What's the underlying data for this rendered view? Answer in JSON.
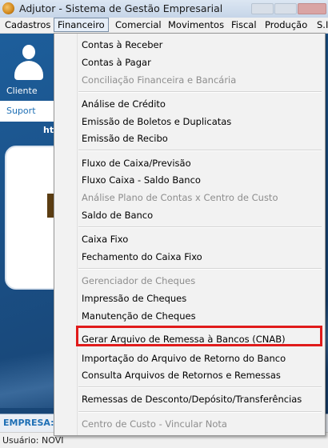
{
  "window": {
    "title": "Adjutor - Sistema de Gestão Empresarial"
  },
  "menubar": {
    "items": [
      "Cadastros",
      "Financeiro",
      "Comercial",
      "Movimentos",
      "Fiscal",
      "Produção",
      "S.I"
    ],
    "active": "Financeiro"
  },
  "background": {
    "clientes_label": "Cliente",
    "suporte_label": "Suport",
    "ht_label": "ht",
    "empresa_label": "EMPRESA:",
    "usuario_label": "Usuário: NOVI"
  },
  "dropdown": {
    "items": [
      {
        "label": "Contas à Receber",
        "enabled": true
      },
      {
        "label": "Contas à Pagar",
        "enabled": true
      },
      {
        "label": "Conciliação Financeira e Bancária",
        "enabled": false
      },
      {
        "label": "Análise de Crédito",
        "enabled": true
      },
      {
        "label": "Emissão de Boletos e Duplicatas",
        "enabled": true
      },
      {
        "label": "Emissão de Recibo",
        "enabled": true
      },
      {
        "label": "Fluxo de Caixa/Previsão",
        "enabled": true
      },
      {
        "label": "Fluxo Caixa - Saldo Banco",
        "enabled": true
      },
      {
        "label": "Análise Plano de Contas x Centro de Custo",
        "enabled": false
      },
      {
        "label": "Saldo de Banco",
        "enabled": true
      },
      {
        "label": "Caixa Fixo",
        "enabled": true
      },
      {
        "label": "Fechamento do Caixa Fixo",
        "enabled": true
      },
      {
        "label": "Gerenciador de Cheques",
        "enabled": false
      },
      {
        "label": "Impressão de Cheques",
        "enabled": true
      },
      {
        "label": "Manutenção de Cheques",
        "enabled": true
      },
      {
        "label": "Gerar Arquivo de Remessa à Bancos (CNAB)",
        "enabled": true,
        "highlighted": true
      },
      {
        "label": "Importação  do Arquivo de Retorno do Banco",
        "enabled": true
      },
      {
        "label": "Consulta Arquivos de Retornos e Remessas",
        "enabled": true
      },
      {
        "label": "Remessas de Desconto/Depósito/Transferências",
        "enabled": true
      },
      {
        "label": "Centro de Custo - Vincular Nota",
        "enabled": false
      }
    ]
  },
  "colors": {
    "highlight_border": "#e01b1b",
    "app_background": "#1a4f85",
    "disabled_text": "#8d8d8d"
  }
}
